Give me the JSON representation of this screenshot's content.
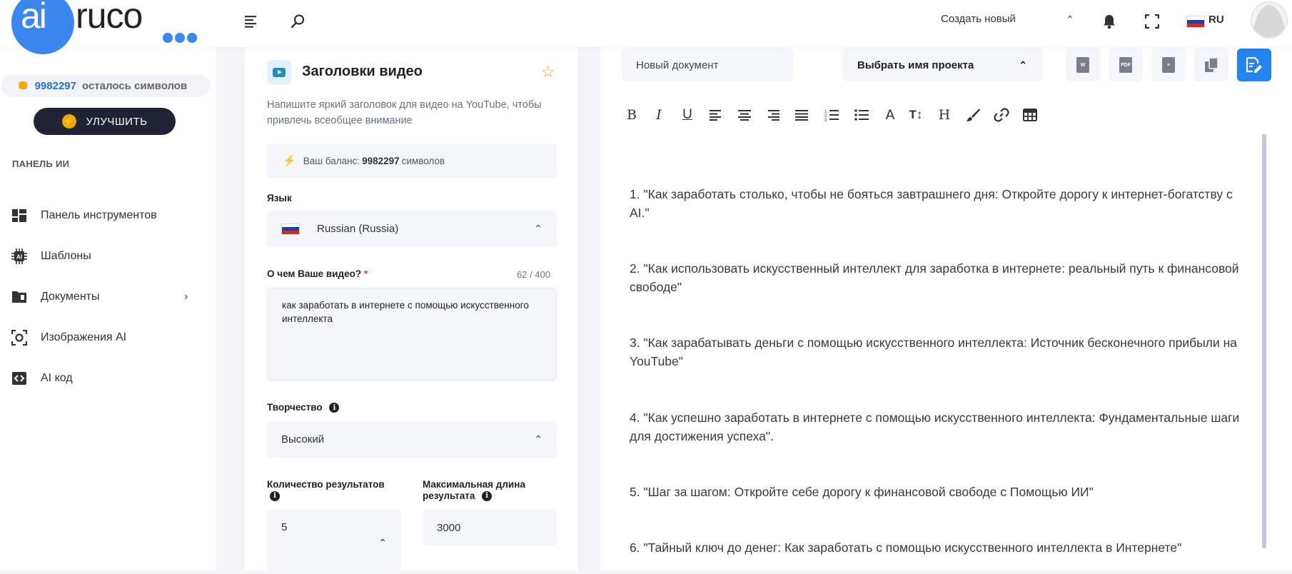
{
  "brand": {
    "logo_ai": "ai",
    "logo_ruco": "ruco"
  },
  "header": {
    "create_new": "Создать новый",
    "lang_code": "RU",
    "icons": [
      "menu-icon",
      "search-icon",
      "bell-icon",
      "fullscreen-icon"
    ]
  },
  "sidebar": {
    "credits_value": "9982297",
    "credits_text": "осталось символов",
    "upgrade_label": "УЛУЧШИТЬ",
    "section_label": "ПАНЕЛЬ ИИ",
    "items": [
      {
        "label": "Панель инструментов",
        "icon": "dashboard-icon"
      },
      {
        "label": "Шаблоны",
        "icon": "ai-chip-icon"
      },
      {
        "label": "Документы",
        "icon": "folder-icon",
        "has_arrow": true
      },
      {
        "label": "Изображения AI",
        "icon": "camera-icon"
      },
      {
        "label": "AI код",
        "icon": "code-icon"
      }
    ]
  },
  "form": {
    "title": "Заголовки видео",
    "description": "Напишите яркий заголовок для видео на YouTube, чтобы привлечь всеобщее внимание",
    "balance_prefix": "Ваш баланс:",
    "balance_value": "9982297",
    "balance_suffix": "символов",
    "language_label": "Язык",
    "language_value": "Russian (Russia)",
    "topic_label": "О чем Ваше видео?",
    "topic_required": "*",
    "topic_counter": "62 / 400",
    "topic_value": "как заработать в интернете с помощью искусственного интеллекта",
    "creativity_label": "Творчество",
    "creativity_value": "Высокий",
    "results_label": "Количество результатов",
    "results_value": "5",
    "maxlen_label": "Максимальная длина результата",
    "maxlen_value": "3000"
  },
  "editor": {
    "doc_name_placeholder": "Новый документ",
    "project_select": "Выбрать имя проекта",
    "export_buttons": [
      "word-export-icon",
      "pdf-export-icon",
      "txt-export-icon",
      "copy-icon"
    ],
    "save_icon": "save-document-icon",
    "toolbar_icons": [
      "bold-icon",
      "italic-icon",
      "underline-icon",
      "align-left-icon",
      "align-center-icon",
      "align-right-icon",
      "justify-icon",
      "ordered-list-icon",
      "bullet-list-icon",
      "font-color-icon",
      "font-size-icon",
      "heading-icon",
      "brush-icon",
      "link-icon",
      "table-icon"
    ],
    "results": [
      "1. \"Как заработать столько, чтобы не бояться завтрашнего дня: Откройте дорогу к интернет-богатству с AI.\"",
      "2. \"Как использовать искусственный интеллект для заработка в интернете: реальный путь к финансовой свободе\"",
      "3. \"Как зарабатывать деньги с помощью искусственного интеллекта: Источник бесконечного прибыли на YouTube\"",
      "4. \"Как успешно заработать в интернете с помощью искусственного интеллекта: Фундаментальные шаги для достижения успеха\".",
      "5. \"Шаг за шагом: Откройте себе дорогу к финансовой свободе с Помощью ИИ\"",
      "6. \"Тайный ключ до денег: Как заработать с помощью искусственного интеллекта в Интернете\""
    ]
  },
  "colors": {
    "accent": "#3b87f0",
    "primary_button": "#2284f0",
    "upgrade_bg": "#1f2333",
    "star": "#f0a020"
  }
}
